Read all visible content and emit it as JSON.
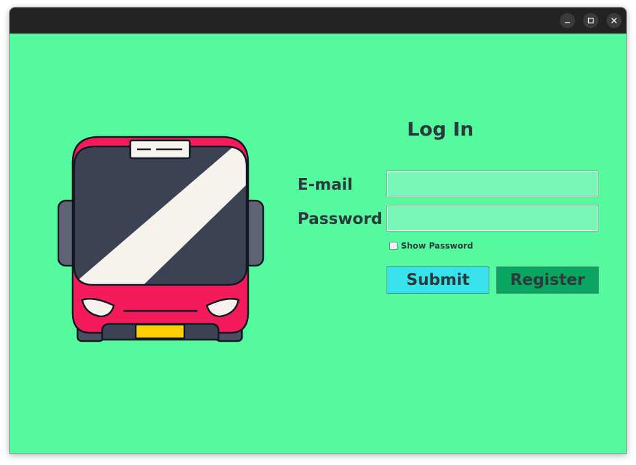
{
  "window": {
    "controls": [
      "minimize-icon",
      "maximize-icon",
      "close-icon"
    ]
  },
  "illustration": {
    "icon": "bus-icon"
  },
  "form": {
    "title": "Log In",
    "email_label": "E-mail",
    "email_value": "",
    "password_label": "Password",
    "password_value": "",
    "show_password_label": "Show Password",
    "show_password_checked": false,
    "submit_label": "Submit",
    "register_label": "Register"
  },
  "colors": {
    "background": "#55fa9f",
    "titlebar": "#222222",
    "input_fill": "#78f8b6",
    "submit_button": "#38e2ec",
    "register_button": "#0aa661",
    "text": "#2a3a3d",
    "bus_body": "#f41b5a",
    "bus_window": "#3a4253"
  }
}
